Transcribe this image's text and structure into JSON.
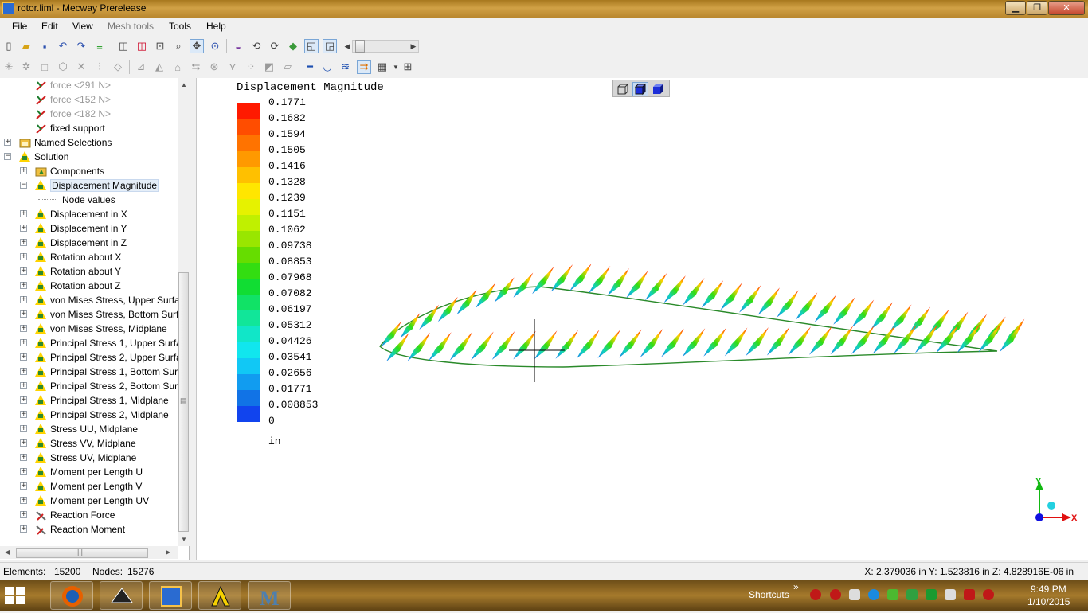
{
  "window": {
    "title": "rotor.liml - Mecway Prerelease",
    "minimize_glyph": "▁",
    "maximize_glyph": "❐",
    "close_glyph": "✕"
  },
  "menu": {
    "file": "File",
    "edit": "Edit",
    "view": "View",
    "mesh_tools": "Mesh tools",
    "tools": "Tools",
    "help": "Help"
  },
  "toolbar_icons": [
    "new-icon",
    "open-icon",
    "save-icon",
    "undo-icon",
    "redo-icon",
    "equals-icon",
    "cube-wire-icon",
    "cube-red-icon",
    "zoom-fit-icon",
    "zoom-icon",
    "pick-icon",
    "zoom-box-icon",
    "sphere-icon",
    "rotate-icon",
    "rotate-icon",
    "paint-icon",
    "view-front-icon",
    "view-iso-icon",
    "slider-left-icon",
    "slider-right-icon"
  ],
  "tree": {
    "items": [
      {
        "label": "force <291 N>"
      },
      {
        "label": "force <152 N>"
      },
      {
        "label": "force <182 N>"
      },
      {
        "label": "fixed support"
      },
      {
        "label": "Named Selections"
      },
      {
        "label": "Solution"
      },
      {
        "label": "Components"
      },
      {
        "label": "Displacement Magnitude"
      },
      {
        "label": "Node values"
      },
      {
        "label": "Displacement in X"
      },
      {
        "label": "Displacement in Y"
      },
      {
        "label": "Displacement in Z"
      },
      {
        "label": "Rotation about X"
      },
      {
        "label": "Rotation about Y"
      },
      {
        "label": "Rotation about Z"
      },
      {
        "label": "von Mises Stress, Upper Surfac"
      },
      {
        "label": "von Mises Stress, Bottom Surf"
      },
      {
        "label": "von Mises Stress, Midplane"
      },
      {
        "label": "Principal Stress 1, Upper Surfa"
      },
      {
        "label": "Principal Stress 2, Upper Surfa"
      },
      {
        "label": "Principal Stress 1, Bottom Surf"
      },
      {
        "label": "Principal Stress 2, Bottom Surf"
      },
      {
        "label": "Principal Stress 1, Midplane"
      },
      {
        "label": "Principal Stress 2, Midplane"
      },
      {
        "label": "Stress UU, Midplane"
      },
      {
        "label": "Stress VV, Midplane"
      },
      {
        "label": "Stress UV, Midplane"
      },
      {
        "label": "Moment per Length U"
      },
      {
        "label": "Moment per Length V"
      },
      {
        "label": "Moment per Length UV"
      },
      {
        "label": "Reaction Force"
      },
      {
        "label": "Reaction Moment"
      }
    ],
    "scroll_glyph": "▤",
    "hscroll_glyph": "|||",
    "expand_plus": "+",
    "expand_minus": "−"
  },
  "legend": {
    "title": "Displacement Magnitude",
    "values": [
      "0.1771",
      "0.1682",
      "0.1594",
      "0.1505",
      "0.1416",
      "0.1328",
      "0.1239",
      "0.1151",
      "0.1062",
      "0.09738",
      "0.08853",
      "0.07968",
      "0.07082",
      "0.06197",
      "0.05312",
      "0.04426",
      "0.03541",
      "0.02656",
      "0.01771",
      "0.008853",
      "0"
    ],
    "colors": [
      "#ff1a00",
      "#ff4d00",
      "#ff7300",
      "#ff9900",
      "#ffc000",
      "#ffe600",
      "#e6f200",
      "#c0f000",
      "#99e600",
      "#66dd00",
      "#33dd11",
      "#11dd33",
      "#11e266",
      "#11e699",
      "#11e6c8",
      "#11e6ee",
      "#11c8f5",
      "#119cf0",
      "#1173e6",
      "#1144ee",
      "#1111ee"
    ],
    "unit": "in"
  },
  "axis": {
    "x_label": "X",
    "y_label": "Y"
  },
  "status": {
    "elements_label": "Elements:",
    "elements_value": "15200",
    "nodes_label": "Nodes:",
    "nodes_value": "15276",
    "coordinates": "X: 2.379036 in Y: 1.523816 in Z: 4.828916E-06 in"
  },
  "taskbar": {
    "shortcuts": "Shortcuts",
    "chevron": "»",
    "time": "9:49 PM",
    "date": "1/10/2015"
  }
}
